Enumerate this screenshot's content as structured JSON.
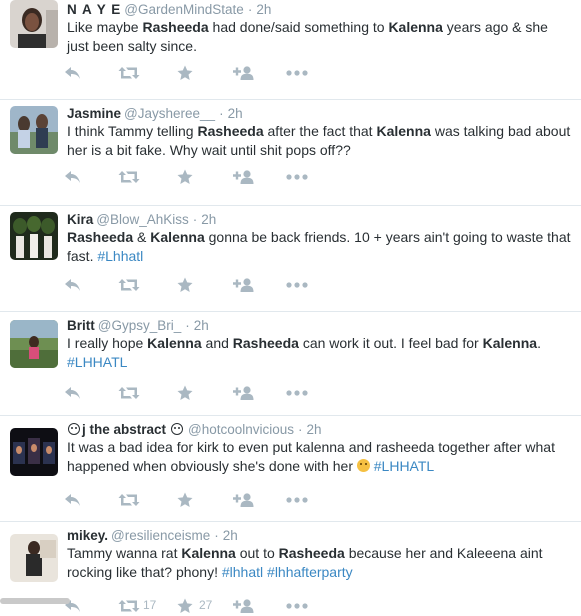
{
  "tweets": [
    {
      "name": "N A Y E",
      "handle": "@GardenMindState",
      "time": "2h",
      "segments": [
        {
          "t": "Like maybe "
        },
        {
          "t": "Rasheeda",
          "b": true
        },
        {
          "t": " had done/said something to "
        },
        {
          "t": "Kalenna",
          "b": true
        },
        {
          "t": " years ago & she just been salty since."
        }
      ]
    },
    {
      "name": "Jasmine",
      "handle": "@Jaysheree__",
      "time": "2h",
      "segments": [
        {
          "t": "I think Tammy telling "
        },
        {
          "t": "Rasheeda",
          "b": true
        },
        {
          "t": " after the fact that "
        },
        {
          "t": "Kalenna",
          "b": true
        },
        {
          "t": " was talking bad about her is a bit fake. Why wait until shit pops off??"
        }
      ]
    },
    {
      "name": "Kira",
      "handle": "@Blow_AhKiss",
      "time": "2h",
      "segments": [
        {
          "t": "Rasheeda",
          "b": true
        },
        {
          "t": " & "
        },
        {
          "t": "Kalenna",
          "b": true
        },
        {
          "t": " gonna be back friends. 10 + years ain't going to waste that fast. "
        },
        {
          "t": "#Lhhatl",
          "tag": true
        }
      ]
    },
    {
      "name": "Britt",
      "handle": "@Gypsy_Bri_",
      "time": "2h",
      "segments": [
        {
          "t": "I really hope "
        },
        {
          "t": "Kalenna",
          "b": true
        },
        {
          "t": " and "
        },
        {
          "t": "Rasheeda",
          "b": true
        },
        {
          "t": " can work it out. I feel bad for "
        },
        {
          "t": "Kalenna",
          "b": true
        },
        {
          "t": ". "
        },
        {
          "t": "#LHHATL",
          "tag": true
        }
      ]
    },
    {
      "name": "j the abstract",
      "handle": "@hotcoolnvicious",
      "time": "2h",
      "segments": [
        {
          "t": "It was a bad idea for kirk to even put kalenna and rasheeda together after what happened when obviously she's done with her "
        },
        {
          "emoji": "unamused-emoji"
        },
        {
          "t": " "
        },
        {
          "t": "#LHHATL",
          "tag": true
        }
      ]
    },
    {
      "name": "mikey.",
      "handle": "@resilienceisme",
      "time": "2h",
      "segments": [
        {
          "t": "Tammy wanna rat "
        },
        {
          "t": "Kalenna",
          "b": true
        },
        {
          "t": " out to "
        },
        {
          "t": "Rasheeda",
          "b": true
        },
        {
          "t": " because her and Kaleeena aint rocking like that? phony! "
        },
        {
          "t": "#lhhatl",
          "tag": true
        },
        {
          "t": " "
        },
        {
          "t": "#lhhafterparty",
          "tag": true
        }
      ]
    }
  ],
  "last_tweet_counts": {
    "retweets": "17",
    "favorites": "27"
  },
  "colors": {
    "accent": "#3b88c3",
    "muted": "#8899a6",
    "icon": "#aab8c2",
    "divider": "#e1e8ed"
  },
  "icons": [
    "reply-icon",
    "retweet-icon",
    "favorite-icon",
    "follow-icon",
    "more-icon"
  ]
}
